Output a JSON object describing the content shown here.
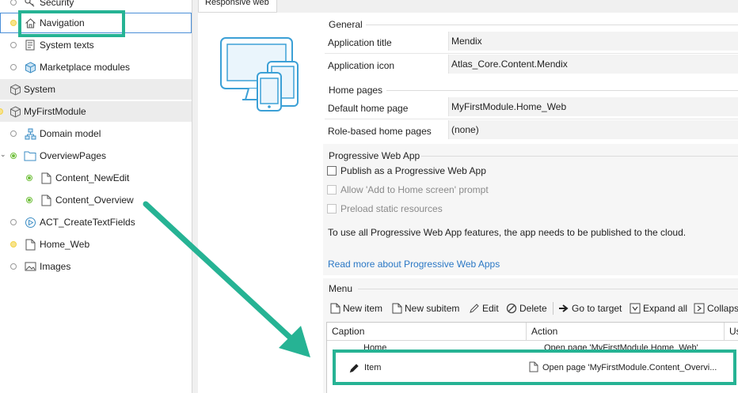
{
  "tree": {
    "items": [
      {
        "label": "Security",
        "icon": "key-icon"
      },
      {
        "label": "Navigation",
        "icon": "home-icon"
      },
      {
        "label": "System texts",
        "icon": "document-text-icon"
      },
      {
        "label": "Marketplace modules",
        "icon": "cube-icon"
      },
      {
        "label": "System",
        "icon": "module-icon"
      },
      {
        "label": "MyFirstModule",
        "icon": "module-icon"
      },
      {
        "label": "Domain model",
        "icon": "domain-model-icon"
      },
      {
        "label": "OverviewPages",
        "icon": "folder-icon"
      },
      {
        "label": "Content_NewEdit",
        "icon": "page-icon"
      },
      {
        "label": "Content_Overview",
        "icon": "page-icon"
      },
      {
        "label": "ACT_CreateTextFields",
        "icon": "microflow-icon"
      },
      {
        "label": "Home_Web",
        "icon": "page-icon"
      },
      {
        "label": "Images",
        "icon": "images-icon"
      }
    ]
  },
  "tab": {
    "label": "Responsive web"
  },
  "general": {
    "title": "General",
    "app_title_label": "Application title",
    "app_title_value": "Mendix",
    "app_icon_label": "Application icon",
    "app_icon_value": "Atlas_Core.Content.Mendix"
  },
  "home": {
    "title": "Home pages",
    "default_label": "Default home page",
    "default_value": "MyFirstModule.Home_Web",
    "role_label": "Role-based home pages",
    "role_value": "(none)"
  },
  "pwa": {
    "title": "Progressive Web App",
    "publish_label": "Publish as a Progressive Web App",
    "publish_checked": false,
    "add_home_label": "Allow 'Add to Home screen' prompt",
    "preload_label": "Preload static resources",
    "note": "To use all Progressive Web App features, the app needs to be published to the cloud.",
    "link": "Read more about Progressive Web Apps"
  },
  "menu": {
    "title": "Menu",
    "toolbar": {
      "new_item": "New item",
      "new_subitem": "New subitem",
      "edit": "Edit",
      "delete": "Delete",
      "go_to_target": "Go to target",
      "expand_all": "Expand all",
      "collapse": "Collaps"
    },
    "columns": [
      "Caption",
      "Action",
      "Use"
    ],
    "rows": [
      {
        "caption": "Home",
        "action": "Open page 'MyFirstModule.Home_Web'"
      },
      {
        "caption": "Item",
        "action": "Open page 'MyFirstModule.Content_Overvi..."
      }
    ]
  },
  "colors": {
    "annotation": "#26b394",
    "link": "#2b78c5",
    "selection_border": "#4a8fd8"
  }
}
